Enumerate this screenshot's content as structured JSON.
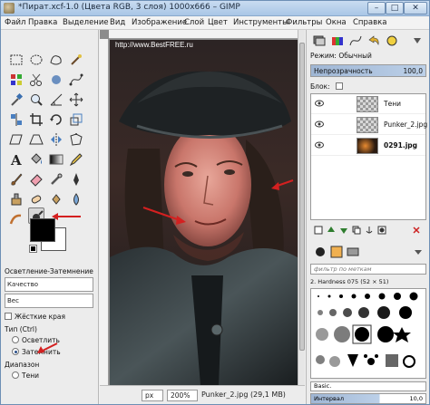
{
  "window": {
    "title": "*Пират.xcf-1.0 (Цвета RGB, 3 слоя) 1000x666 – GIMP",
    "min_label": "–",
    "max_label": "□",
    "close_label": "✕"
  },
  "menu": [
    "Файл",
    "Правка",
    "Выделение",
    "Вид",
    "Изображение",
    "Слой",
    "Цвет",
    "Инструменты",
    "Фильтры",
    "Окна",
    "Справка"
  ],
  "watermark": "http://www.BestFREE.ru",
  "tool_options": {
    "title": "Осветление-Затемнение",
    "field1": "Качество",
    "field2": "Вес",
    "hard_edge": "Жёсткие края",
    "type_label": "Тип (Ctrl)",
    "radio_lighten": "Осветлить",
    "radio_darken": "Затемнить",
    "range_label": "Диапазон",
    "range_option": "Тени"
  },
  "status": {
    "unit": "px",
    "zoom": "200%",
    "info": "Punker_2.jpg (29,1 MB)"
  },
  "dock": {
    "mode_label": "Режим:",
    "mode_value": "Обычный",
    "opacity_label": "Непрозрачность",
    "opacity_value": "100,0",
    "lock_label": "Блок:",
    "layers": [
      {
        "name": "Тени",
        "visible": true
      },
      {
        "name": "Punker_2.jpg",
        "visible": true
      },
      {
        "name": "0291.jpg",
        "visible": true
      }
    ],
    "brush_filter": "фильтр по меткам",
    "brush_name": "2. Hardness 075 (52 × 51)",
    "brush_preset": "Basic.",
    "spacing_label": "Интервал",
    "spacing_value": "10,0"
  },
  "colors": {
    "accent": "#d42020",
    "selection": "#9fb6d4",
    "foreground": "#000000",
    "background": "#ffffff"
  }
}
